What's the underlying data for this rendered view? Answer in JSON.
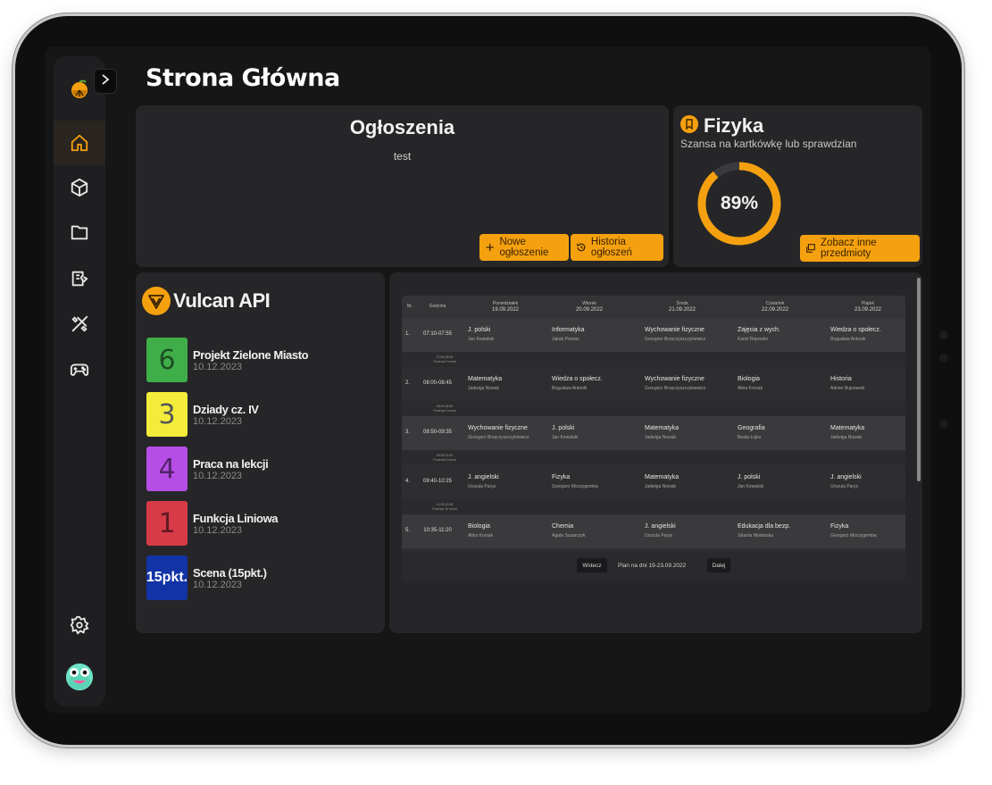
{
  "page": {
    "title": "Strona Główna"
  },
  "sidebar": {
    "items": [
      {
        "name": "home",
        "active": true
      },
      {
        "name": "cube"
      },
      {
        "name": "folder"
      },
      {
        "name": "ticket"
      },
      {
        "name": "tools"
      },
      {
        "name": "gamepad"
      }
    ]
  },
  "announcements": {
    "title": "Ogłoszenia",
    "text": "test",
    "new_label": "Nowe ogłoszenie",
    "history_label": "Historia ogłoszeń"
  },
  "physics": {
    "title": "Fizyka",
    "subtitle": "Szansa na kartkówkę lub sprawdzian",
    "chance_label": "89%",
    "chance_fraction": 0.89,
    "other_label": "Zobacz inne przedmioty"
  },
  "vulcan": {
    "title": "Vulcan API",
    "grades": [
      {
        "value": "6",
        "name": "Projekt Zielone Miasto",
        "date": "10.12.2023",
        "color": "#3fae49"
      },
      {
        "value": "3",
        "name": "Dziady cz. IV",
        "date": "10.12.2023",
        "color": "#f3ec3a"
      },
      {
        "value": "4",
        "name": "Praca na lekcji",
        "date": "10.12.2023",
        "color": "#b64ee6"
      },
      {
        "value": "1",
        "name": "Funkcja Liniowa",
        "date": "10.12.2023",
        "color": "#d63b47"
      },
      {
        "value": "15pkt.",
        "name": "Scena (15pkt.)",
        "date": "10.12.2023",
        "color": "#1233a6"
      }
    ]
  },
  "timetable": {
    "head_nr": "Nr.",
    "head_hour": "Godzina",
    "days": [
      {
        "name": "Poniedziałek",
        "date": "19.09.2022"
      },
      {
        "name": "Wtorek",
        "date": "20.09.2022"
      },
      {
        "name": "Środa",
        "date": "21.09.2022"
      },
      {
        "name": "Czwartek",
        "date": "22.09.2022"
      },
      {
        "name": "Piątek",
        "date": "23.09.2022"
      }
    ],
    "rows": [
      {
        "nr": "1.",
        "hours": "07:10-07:55",
        "lessons": [
          {
            "subject": "J. polski",
            "teacher": "Jan Kowalski"
          },
          {
            "subject": "Informatyka",
            "teacher": "Jakub Perzan"
          },
          {
            "subject": "Wychowanie fizyczne",
            "teacher": "Grzegorz Brzęczyszczykiewicz"
          },
          {
            "subject": "Zajęcia z wych.",
            "teacher": "Kamil Rojewski"
          },
          {
            "subject": "Wiedza o społecz.",
            "teacher": "Bogusław Antonik"
          }
        ]
      },
      {
        "nr": "2.",
        "hours": "08:00-08:45",
        "lessons": [
          {
            "subject": "Matematyka",
            "teacher": "Jadwiga Nowak"
          },
          {
            "subject": "Wiedza o społecz.",
            "teacher": "Bogusław Antonik"
          },
          {
            "subject": "Wychowanie fizyczne",
            "teacher": "Grzegorz Brzęczyszczykiewicz"
          },
          {
            "subject": "Biologia",
            "teacher": "Alina Korsak"
          },
          {
            "subject": "Historia",
            "teacher": "Adrian Bujnowski"
          }
        ]
      },
      {
        "nr": "3.",
        "hours": "08:50-09:35",
        "lessons": [
          {
            "subject": "Wychowanie fizyczne",
            "teacher": "Grzegorz Brzęczyszczykiewicz"
          },
          {
            "subject": "J. polski",
            "teacher": "Jan Kowalski"
          },
          {
            "subject": "Matematyka",
            "teacher": "Jadwiga Nowak"
          },
          {
            "subject": "Geografia",
            "teacher": "Beata Łojko"
          },
          {
            "subject": "Matematyka",
            "teacher": "Jadwiga Nowak"
          }
        ]
      },
      {
        "nr": "4.",
        "hours": "09:40-10:25",
        "lessons": [
          {
            "subject": "J. angielski",
            "teacher": "Urszula Parys"
          },
          {
            "subject": "Fizyka",
            "teacher": "Grzegorz Moczygemba"
          },
          {
            "subject": "Matematyka",
            "teacher": "Jadwiga Nowak"
          },
          {
            "subject": "J. polski",
            "teacher": "Jan Kowalski"
          },
          {
            "subject": "J. angielski",
            "teacher": "Urszula Parys"
          }
        ]
      },
      {
        "nr": "5.",
        "hours": "10:35-11:20",
        "lessons": [
          {
            "subject": "Biologia",
            "teacher": "Alina Korsak"
          },
          {
            "subject": "Chemia",
            "teacher": "Agata Susarczyk"
          },
          {
            "subject": "J. angielski",
            "teacher": "Urszula Parys"
          },
          {
            "subject": "Edukacja dla bezp.",
            "teacher": "Jolanta Wodarska"
          },
          {
            "subject": "Fizyka",
            "teacher": "Grzegorz Moczygemba"
          }
        ]
      }
    ],
    "breaks": [
      {
        "time": "07:55-08:00",
        "label": "Przerwa 5 minut"
      },
      {
        "time": "08:45-08:50",
        "label": "Przerwa 5 minut"
      },
      {
        "time": "09:35-09:40",
        "label": "Przerwa 5 minut"
      },
      {
        "time": "10:25-10:35",
        "label": "Przerwa 10 minut"
      }
    ],
    "prev_label": "Wstecz",
    "range_label": "Plan na dni 19-23.09.2022",
    "next_label": "Dalej"
  },
  "colors": {
    "accent": "#f5a10f",
    "card": "#262628",
    "background": "#161617"
  }
}
